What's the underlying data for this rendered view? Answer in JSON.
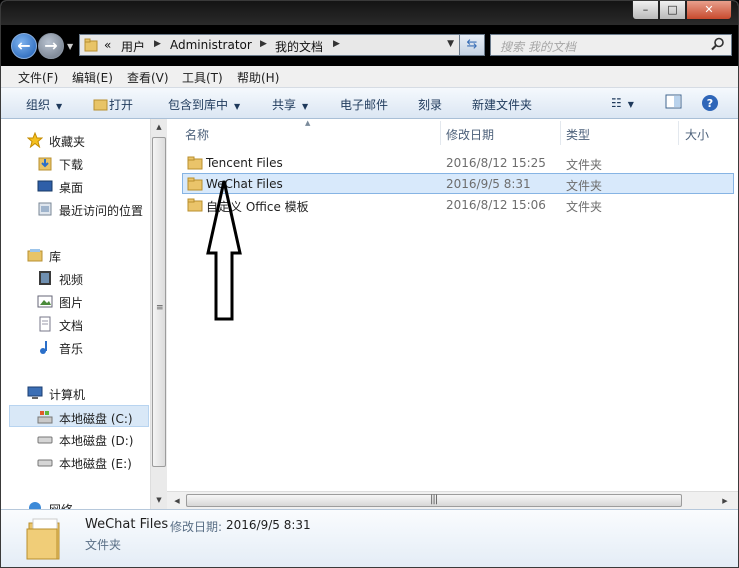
{
  "window": {
    "controls": {
      "minimize": "–",
      "maximize": "□",
      "close": "✕"
    }
  },
  "address": {
    "overflow": "«",
    "segments": [
      "用户",
      "Administrator",
      "我的文档"
    ]
  },
  "search": {
    "placeholder": "搜索 我的文档"
  },
  "menu": [
    "文件(F)",
    "编辑(E)",
    "查看(V)",
    "工具(T)",
    "帮助(H)"
  ],
  "toolbar": {
    "organize": "组织",
    "open": "打开",
    "include_in_library": "包含到库中",
    "share": "共享",
    "email": "电子邮件",
    "burn": "刻录",
    "new_folder": "新建文件夹"
  },
  "sidebar": {
    "favorites": {
      "label": "收藏夹",
      "items": [
        "下载",
        "桌面",
        "最近访问的位置"
      ]
    },
    "libraries": {
      "label": "库",
      "items": [
        "视频",
        "图片",
        "文档",
        "音乐"
      ]
    },
    "computer": {
      "label": "计算机",
      "items": [
        "本地磁盘 (C:)",
        "本地磁盘 (D:)",
        "本地磁盘 (E:)"
      ],
      "selected_index": 0
    },
    "network": {
      "label": "网络"
    }
  },
  "columns": {
    "name": "名称",
    "date": "修改日期",
    "type": "类型",
    "size": "大小"
  },
  "files": [
    {
      "name": "Tencent Files",
      "date": "2016/8/12 15:25",
      "type": "文件夹",
      "selected": false
    },
    {
      "name": "WeChat Files",
      "date": "2016/9/5 8:31",
      "type": "文件夹",
      "selected": true
    },
    {
      "name": "自定义 Office 模板",
      "date": "2016/8/12 15:06",
      "type": "文件夹",
      "selected": false
    }
  ],
  "details": {
    "name": "WeChat Files",
    "date_label": "修改日期:",
    "date_value": "2016/9/5 8:31",
    "type": "文件夹"
  },
  "colors": {
    "selection": "#d8e9fb",
    "toolbar_text": "#1e395b",
    "annotation": "#000000"
  }
}
